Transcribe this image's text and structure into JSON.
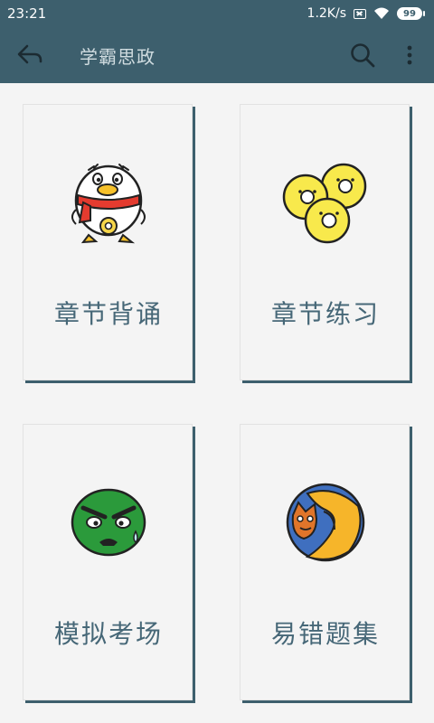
{
  "status_bar": {
    "time": "23:21",
    "network_speed": "1.2K/s",
    "battery": "99",
    "icons": [
      "no-sim-icon",
      "wifi-icon",
      "battery-icon"
    ]
  },
  "app_bar": {
    "title": "学霸思政",
    "back_icon": "back-arrow-icon",
    "search_icon": "search-icon",
    "more_icon": "more-vertical-icon",
    "background": "#3d5f6d"
  },
  "cards": [
    {
      "label": "章节背诵",
      "icon": "penguin-with-scarf-icon"
    },
    {
      "label": "章节练习",
      "icon": "three-chicks-icon"
    },
    {
      "label": "模拟考场",
      "icon": "angry-green-face-icon"
    },
    {
      "label": "易错题集",
      "icon": "fox-globe-icon"
    }
  ],
  "colors": {
    "accent": "#3d5f6d",
    "label_text": "#466777",
    "page_background": "#f4f4f4"
  }
}
